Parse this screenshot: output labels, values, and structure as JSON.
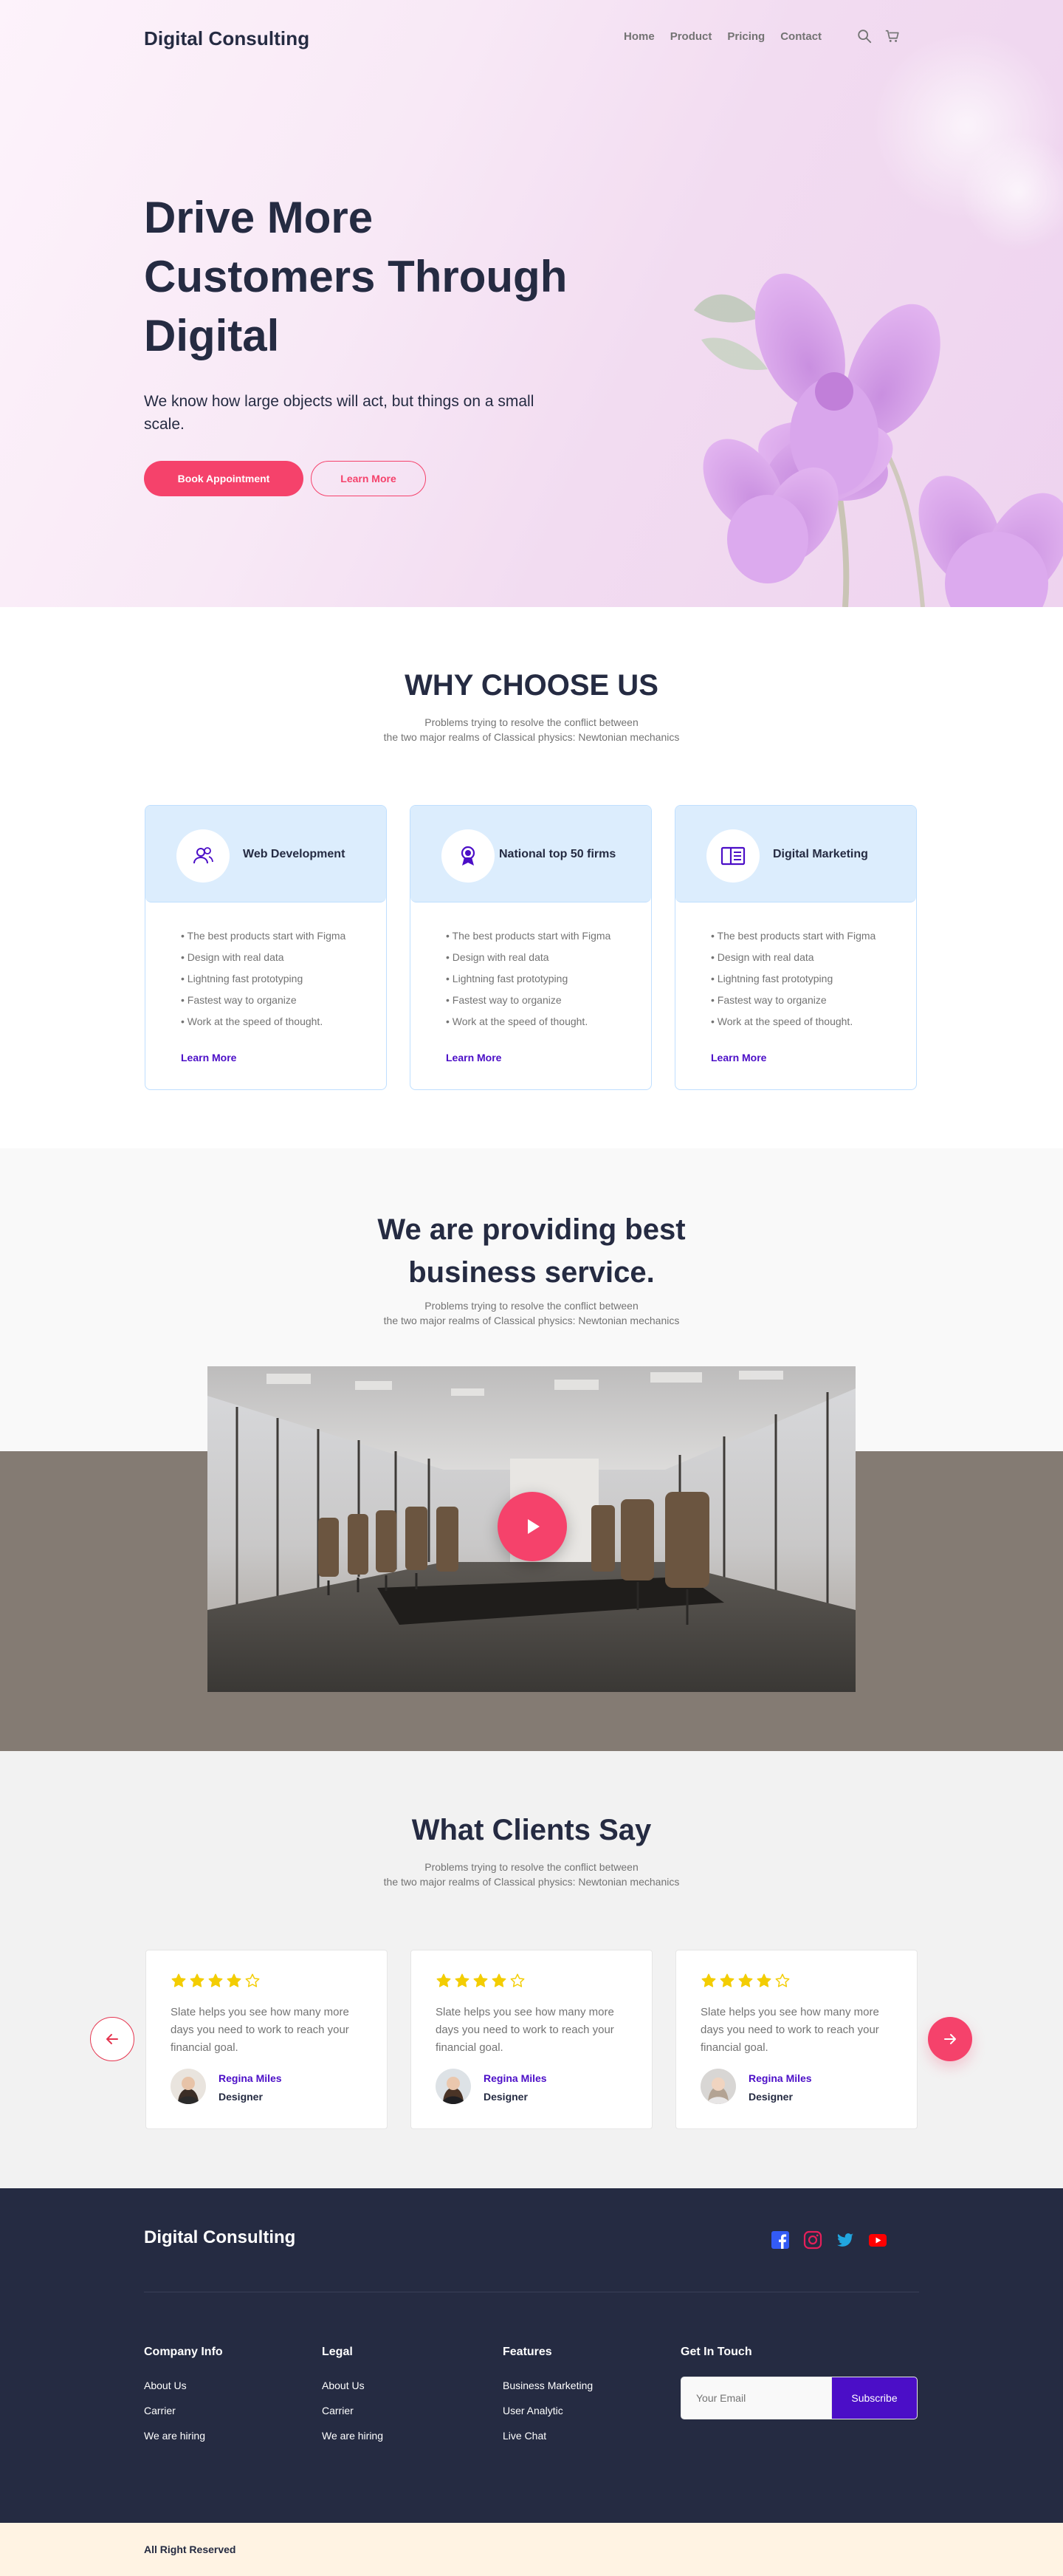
{
  "nav": {
    "brand": "Digital Consulting",
    "links": [
      "Home",
      "Product",
      "Pricing",
      "Contact"
    ],
    "icons": [
      "search-icon",
      "cart-icon"
    ]
  },
  "hero": {
    "title": "Drive More Customers Through Digital",
    "subtitle": "We know how large objects will act, but things on a small scale.",
    "primary_cta": "Book Appointment",
    "secondary_cta": "Learn More"
  },
  "why": {
    "title": "WHY CHOOSE US",
    "desc_lines": [
      "Problems trying to resolve the conflict between",
      "the two major realms of Classical physics: Newtonian mechanics"
    ],
    "cards": [
      {
        "icon": "users-icon",
        "title": "Web Development",
        "items": [
          "The best products start with Figma",
          "Design with real data",
          "Lightning fast prototyping",
          "Fastest way to organize",
          "Work at the speed of thought."
        ],
        "link": "Learn More"
      },
      {
        "icon": "award-icon",
        "title": "National top 50 firms",
        "items": [
          "The best products start with Figma",
          "Design with real data",
          "Lightning fast prototyping",
          "Fastest way to organize",
          "Work at the speed of thought."
        ],
        "link": "Learn More"
      },
      {
        "icon": "book-icon",
        "title": "Digital Marketing",
        "items": [
          "The best products start with Figma",
          "Design with real data",
          "Lightning fast prototyping",
          "Fastest way to organize",
          "Work at the speed of thought."
        ],
        "link": "Learn More"
      }
    ]
  },
  "video": {
    "title_lines": [
      "We are providing best",
      "business service."
    ],
    "desc_lines": [
      "Problems trying to resolve the conflict between",
      "the two major realms of Classical physics: Newtonian mechanics"
    ]
  },
  "testimonials": {
    "title": "What Clients Say",
    "desc_lines": [
      "Problems trying to resolve the conflict between",
      "the two major realms of Classical physics: Newtonian mechanics"
    ],
    "items": [
      {
        "rating": 4,
        "quote": "Slate helps you see how many more days you need to work to reach your financial goal.",
        "name": "Regina Miles",
        "role": "Designer"
      },
      {
        "rating": 4,
        "quote": "Slate helps you see how many more days you need to work to reach your financial goal.",
        "name": "Regina Miles",
        "role": "Designer"
      },
      {
        "rating": 4,
        "quote": "Slate helps you see how many more days you need to work to reach your financial goal.",
        "name": "Regina Miles",
        "role": "Designer"
      }
    ]
  },
  "footer": {
    "brand": "Digital Consulting",
    "social": [
      "facebook-icon",
      "instagram-icon",
      "twitter-icon",
      "youtube-icon"
    ],
    "columns": [
      {
        "title": "Company Info",
        "links": [
          "About Us",
          "Carrier",
          "We are hiring"
        ]
      },
      {
        "title": "Legal",
        "links": [
          "About Us",
          "Carrier",
          "We are hiring"
        ]
      },
      {
        "title": "Features",
        "links": [
          "Business Marketing",
          "User Analytic",
          "Live Chat"
        ]
      }
    ],
    "newsletter": {
      "title": "Get In Touch",
      "placeholder": "Your Email",
      "button": "Subscribe"
    },
    "copyright": "All Right Reserved"
  },
  "colors": {
    "accent": "#F5426B",
    "primary": "#4B0EC7",
    "dark": "#252B42",
    "muted": "#737373",
    "card_head": "#DCEDFD",
    "star": "#F3CD03"
  }
}
